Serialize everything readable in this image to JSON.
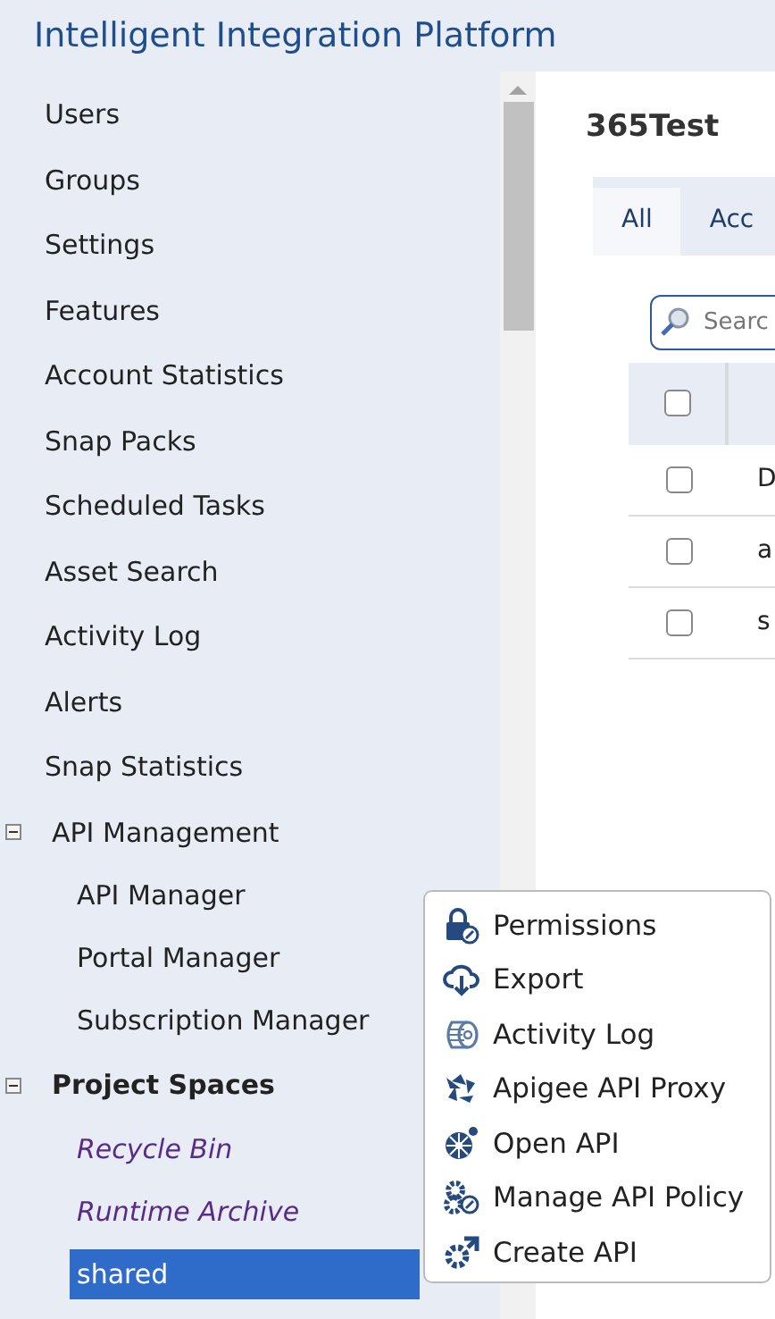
{
  "header": {
    "title": "Intelligent Integration Platform"
  },
  "sidebar": {
    "items": [
      {
        "label": "Users",
        "kind": "link",
        "selected": false
      },
      {
        "label": "Groups",
        "kind": "link",
        "selected": false
      },
      {
        "label": "Settings",
        "kind": "link",
        "selected": false
      },
      {
        "label": "Features",
        "kind": "link",
        "selected": false
      },
      {
        "label": "Account Statistics",
        "kind": "link",
        "selected": false
      },
      {
        "label": "Snap Packs",
        "kind": "link",
        "selected": false
      },
      {
        "label": "Scheduled Tasks",
        "kind": "link",
        "selected": false
      },
      {
        "label": "Asset Search",
        "kind": "link",
        "selected": false
      },
      {
        "label": "Activity Log",
        "kind": "link",
        "selected": false
      },
      {
        "label": "Alerts",
        "kind": "link",
        "selected": false
      },
      {
        "label": "Snap Statistics",
        "kind": "link",
        "selected": false
      },
      {
        "label": "API Management",
        "kind": "group",
        "expanded": true,
        "selected": false,
        "children": [
          {
            "label": "API Manager",
            "kind": "link",
            "selected": false
          },
          {
            "label": "Portal Manager",
            "kind": "link",
            "selected": false
          },
          {
            "label": "Subscription Manager",
            "kind": "link",
            "selected": false
          }
        ]
      },
      {
        "label": "Project Spaces",
        "kind": "section",
        "expanded": true,
        "selected": false,
        "children": [
          {
            "label": "Recycle Bin",
            "kind": "system",
            "selected": false
          },
          {
            "label": "Runtime Archive",
            "kind": "system",
            "selected": false
          },
          {
            "label": "shared",
            "kind": "link",
            "selected": true
          }
        ]
      }
    ]
  },
  "main": {
    "title": "365Test",
    "tabs": [
      {
        "label": "All",
        "selected": true
      },
      {
        "label": "Acc",
        "selected": false
      }
    ],
    "search": {
      "placeholder": "Searc"
    },
    "table": {
      "header_checked": false,
      "rows": [
        {
          "checked": false,
          "column_2": "D"
        },
        {
          "checked": false,
          "column_2": "a"
        },
        {
          "checked": false,
          "column_2": "s"
        }
      ]
    }
  },
  "context_menu": {
    "items": [
      {
        "label": "Permissions"
      },
      {
        "label": "Export"
      },
      {
        "label": "Activity Log"
      },
      {
        "label": "Apigee API Proxy"
      },
      {
        "label": "Open API"
      },
      {
        "label": "Manage API Policy"
      },
      {
        "label": "Create API"
      }
    ]
  }
}
